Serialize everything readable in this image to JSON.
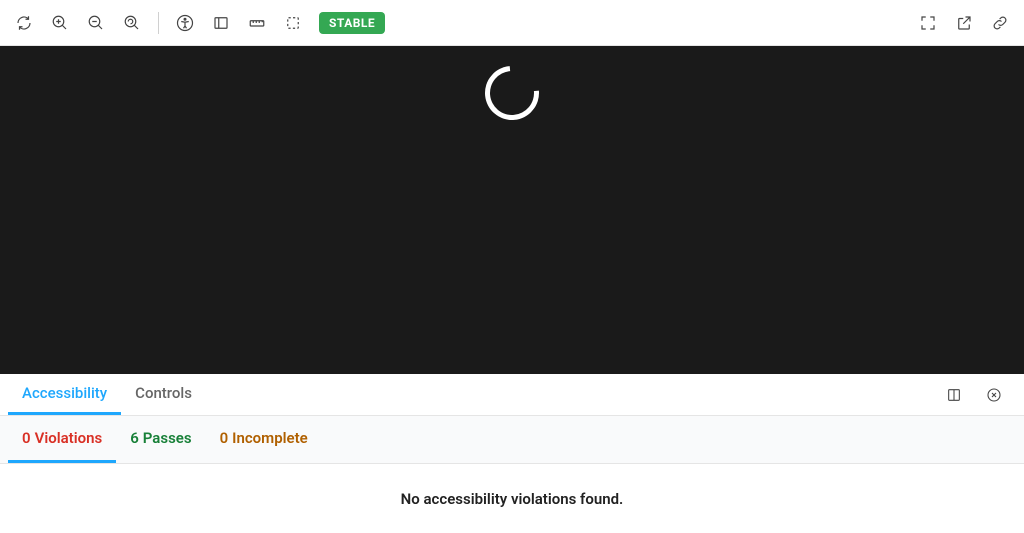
{
  "toolbar": {
    "badge": "STABLE"
  },
  "panel": {
    "tabs": {
      "accessibility": "Accessibility",
      "controls": "Controls"
    },
    "subTabs": {
      "violations": {
        "count": "0",
        "label": "Violations"
      },
      "passes": {
        "count": "6",
        "label": "Passes"
      },
      "incomplete": {
        "count": "0",
        "label": "Incomplete"
      }
    },
    "message": "No accessibility violations found."
  }
}
